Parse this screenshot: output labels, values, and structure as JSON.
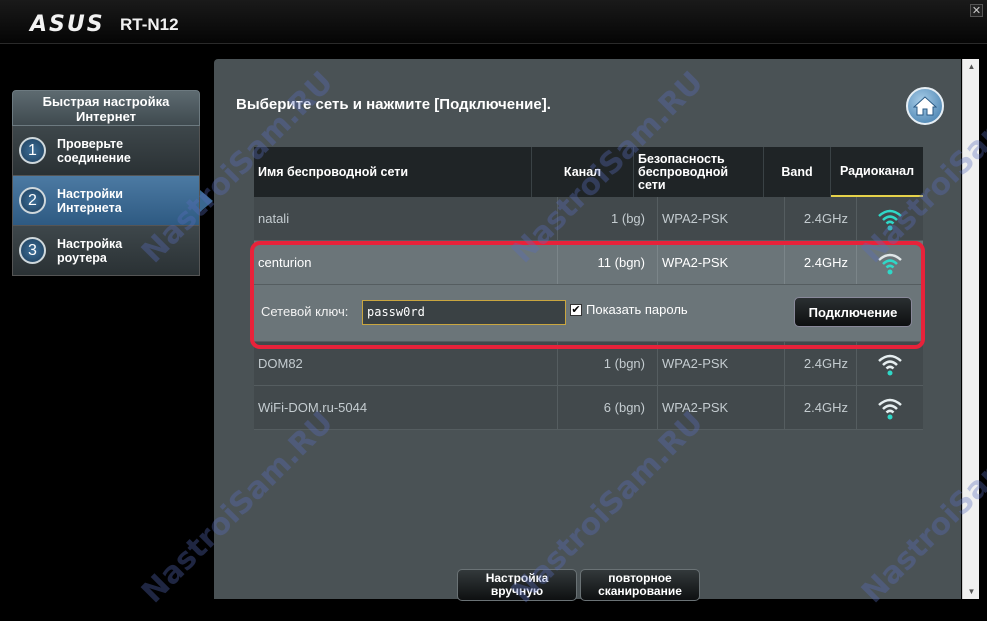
{
  "header": {
    "brand": "ASUS",
    "model": "RT-N12"
  },
  "sidebar": {
    "title": "Быстрая настройка Интернет",
    "items": [
      {
        "num": "1",
        "label": "Проверьте соединение"
      },
      {
        "num": "2",
        "label": "Настройки Интернета"
      },
      {
        "num": "3",
        "label": "Настройка роутера"
      }
    ]
  },
  "main": {
    "title": "Выберите сеть и нажмите [Подключение].",
    "columns": [
      "Имя беспроводной сети",
      "Канал",
      "Безопасность беспроводной сети",
      "Band",
      "Радиоканал"
    ],
    "networks": [
      {
        "name": "natali",
        "channel": "1 (bg)",
        "security": "WPA2-PSK",
        "band": "2.4GHz"
      },
      {
        "name": "centurion",
        "channel": "11 (bgn)",
        "security": "WPA2-PSK",
        "band": "2.4GHz"
      },
      {
        "name": "DOM82",
        "channel": "1 (bgn)",
        "security": "WPA2-PSK",
        "band": "2.4GHz"
      },
      {
        "name": "WiFi-DOM.ru-5044",
        "channel": "6 (bgn)",
        "security": "WPA2-PSK",
        "band": "2.4GHz"
      }
    ],
    "key_label": "Сетевой ключ:",
    "key_value": "passw0rd",
    "show_password_label": "Показать пароль",
    "connect_button": "Подключение"
  },
  "buttons": {
    "manual": "Настройка вручную",
    "rescan": "повторное сканирование"
  },
  "watermark": "NastroiSam.RU",
  "colors": {
    "selection_outline": "#e8223a",
    "signal_strong": "#2fd8c8",
    "signal_weak": "#e6eef0"
  }
}
